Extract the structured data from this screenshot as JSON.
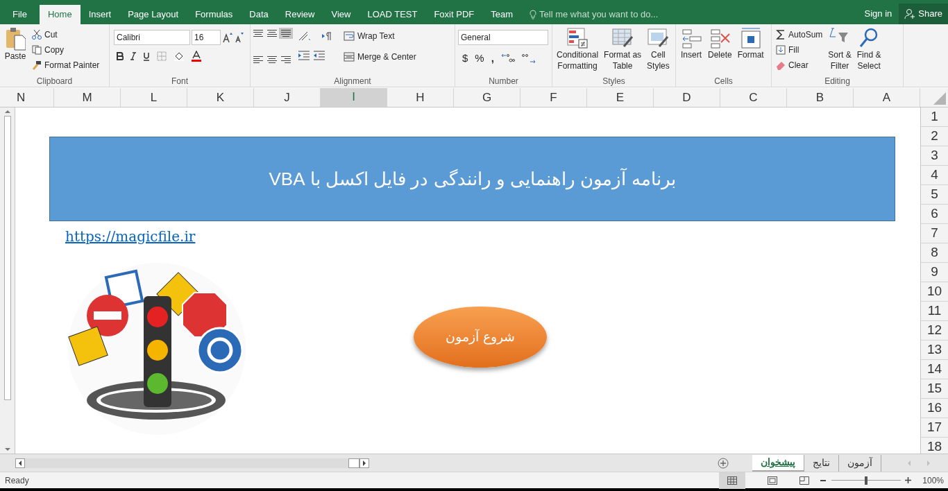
{
  "menu_tabs": [
    {
      "label": "File",
      "selected": false
    },
    {
      "label": "Home",
      "selected": true
    },
    {
      "label": "Insert",
      "selected": false
    },
    {
      "label": "Page Layout",
      "selected": false
    },
    {
      "label": "Formulas",
      "selected": false
    },
    {
      "label": "Data",
      "selected": false
    },
    {
      "label": "Review",
      "selected": false
    },
    {
      "label": "View",
      "selected": false
    },
    {
      "label": "LOAD TEST",
      "selected": false
    },
    {
      "label": "Foxit PDF",
      "selected": false
    },
    {
      "label": "Team",
      "selected": false
    }
  ],
  "tell_me": {
    "placeholder": "Tell me what you want to do..."
  },
  "sign_in": "Sign in",
  "share": "Share",
  "ribbon": {
    "clipboard": {
      "label": "Clipboard",
      "paste": "Paste",
      "cut": "Cut",
      "copy": "Copy",
      "format_painter": "Format Painter"
    },
    "font": {
      "label": "Font",
      "font_name": "Calibri",
      "font_size": "16"
    },
    "alignment": {
      "label": "Alignment",
      "wrap_text": "Wrap Text",
      "merge_center": "Merge & Center"
    },
    "number": {
      "label": "Number",
      "format": "General",
      "currency": "$",
      "percent": "%",
      "comma": ","
    },
    "styles": {
      "label": "Styles",
      "buttons": [
        {
          "lines": [
            "Conditional",
            "Formatting"
          ]
        },
        {
          "lines": [
            "Format as",
            "Table"
          ]
        },
        {
          "lines": [
            "Cell",
            "Styles"
          ]
        }
      ]
    },
    "cells": {
      "label": "Cells",
      "buttons": [
        "Insert",
        "Delete",
        "Format"
      ]
    },
    "editing": {
      "label": "Editing",
      "autosum": "AutoSum",
      "fill": "Fill",
      "clear": "Clear",
      "buttons": [
        {
          "lines": [
            "Sort &",
            "Filter"
          ]
        },
        {
          "lines": [
            "Find &",
            "Select"
          ]
        }
      ]
    }
  },
  "columns": [
    {
      "label": "N",
      "selected": false
    },
    {
      "label": "M",
      "selected": false
    },
    {
      "label": "L",
      "selected": false
    },
    {
      "label": "K",
      "selected": false
    },
    {
      "label": "J",
      "selected": false
    },
    {
      "label": "I",
      "selected": true
    },
    {
      "label": "H",
      "selected": false
    },
    {
      "label": "G",
      "selected": false
    },
    {
      "label": "F",
      "selected": false
    },
    {
      "label": "E",
      "selected": false
    },
    {
      "label": "D",
      "selected": false
    },
    {
      "label": "C",
      "selected": false
    },
    {
      "label": "B",
      "selected": false
    },
    {
      "label": "A",
      "selected": false
    }
  ],
  "rows": [
    "1",
    "2",
    "3",
    "4",
    "5",
    "6",
    "7",
    "8",
    "9",
    "10",
    "11",
    "12",
    "13",
    "14",
    "15",
    "16",
    "17",
    "18"
  ],
  "sheet": {
    "banner": "برنامه آزمون راهنمایی و رانندگی در فایل اکسل با VBA",
    "link": "https://magicfile.ir",
    "start_button": "شروع آزمون"
  },
  "sheet_tabs": [
    {
      "label": "آزمون",
      "selected": false
    },
    {
      "label": "نتایج",
      "selected": false
    },
    {
      "label": "پیشخوان",
      "selected": true
    }
  ],
  "status_bar": {
    "text": "Ready",
    "zoom": "100%",
    "zoom_level": {
      "level": 0.5
    }
  }
}
